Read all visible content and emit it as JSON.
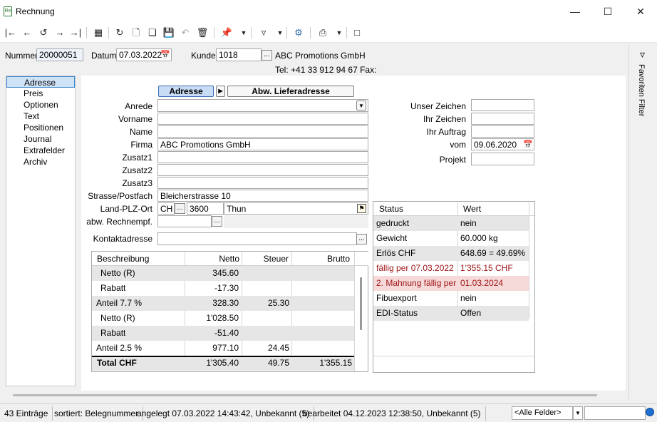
{
  "window": {
    "title": "Rechnung",
    "icon_text": "Re"
  },
  "header": {
    "nummer_label": "Nummer",
    "nummer_value": "20000051",
    "datum_label": "Datum",
    "datum_value": "07.03.2022",
    "kunde_label": "Kunde",
    "kunde_value": "1018",
    "kunde_btn": "...",
    "kunde_name": "ABC Promotions GmbH",
    "contact": "Tel: +41 33 912 94 67   Fax:"
  },
  "right_strip": {
    "label": "Favoriten Filter"
  },
  "nav": {
    "items": [
      "Adresse",
      "Preis",
      "Optionen",
      "Text",
      "Positionen",
      "Journal",
      "Extrafelder",
      "Archiv"
    ],
    "selected": "Adresse"
  },
  "tabs": {
    "adresse": "Adresse",
    "arrow": "▶",
    "lieferadresse": "Abw. Lieferadresse"
  },
  "form": {
    "anrede": "Anrede",
    "vorname": "Vorname",
    "name": "Name",
    "firma": "Firma",
    "firma_value": "ABC Promotions GmbH",
    "zusatz1": "Zusatz1",
    "zusatz2": "Zusatz2",
    "zusatz3": "Zusatz3",
    "strasse": "Strasse/Postfach",
    "strasse_value": "Bleicherstrasse 10",
    "landplzort": "Land-PLZ-Ort",
    "land_value": "CH",
    "plz_value": "3600",
    "ort_value": "Thun",
    "rechnempf": "abw. Rechnempf.",
    "kontakt": "Kontaktadresse",
    "dots": "..."
  },
  "right_form": {
    "unser_zeichen": "Unser Zeichen",
    "ihr_zeichen": "Ihr Zeichen",
    "ihr_auftrag": "Ihr Auftrag",
    "vom": "vom",
    "vom_value": "09.06.2020",
    "projekt": "Projekt"
  },
  "totals_table": {
    "headers": [
      "Beschreibung",
      "Netto",
      "Steuer",
      "Brutto"
    ],
    "rows": [
      [
        "Netto (R)",
        "345.60",
        "",
        ""
      ],
      [
        "Rabatt",
        "-17.30",
        "",
        ""
      ],
      [
        "Anteil 7.7 %",
        "328.30",
        "25.30",
        ""
      ],
      [
        "Netto (R)",
        "1'028.50",
        "",
        ""
      ],
      [
        "Rabatt",
        "-51.40",
        "",
        ""
      ],
      [
        "Anteil 2.5 %",
        "977.10",
        "24.45",
        ""
      ]
    ],
    "total": [
      "Total CHF",
      "1'305.40",
      "49.75",
      "1'355.15"
    ]
  },
  "status_table": {
    "headers": [
      "Status",
      "Wert"
    ],
    "rows": [
      [
        "gedruckt",
        "nein"
      ],
      [
        "Gewicht",
        "60.000 kg"
      ],
      [
        "Erlös CHF",
        "648.69 = 49.69%"
      ],
      [
        "fällig per 07.03.2022",
        "1'355.15 CHF"
      ],
      [
        "2. Mahnung fällig per",
        "01.03.2024"
      ],
      [
        "Fibuexport",
        "nein"
      ],
      [
        "EDI-Status",
        "Offen"
      ]
    ],
    "colors": {
      "due": "#a01818",
      "warning_bg": "#f6d9d9"
    }
  },
  "statusbar": {
    "count": "43 Einträge",
    "sort": "sortiert: Belegnummer",
    "created": "angelegt 07.03.2022 14:43:42, Unbekannt (5)",
    "edited": "bearbeitet 04.12.2023 12:38:50, Unbekannt (5)",
    "filter_field": "<Alle Felder>"
  }
}
